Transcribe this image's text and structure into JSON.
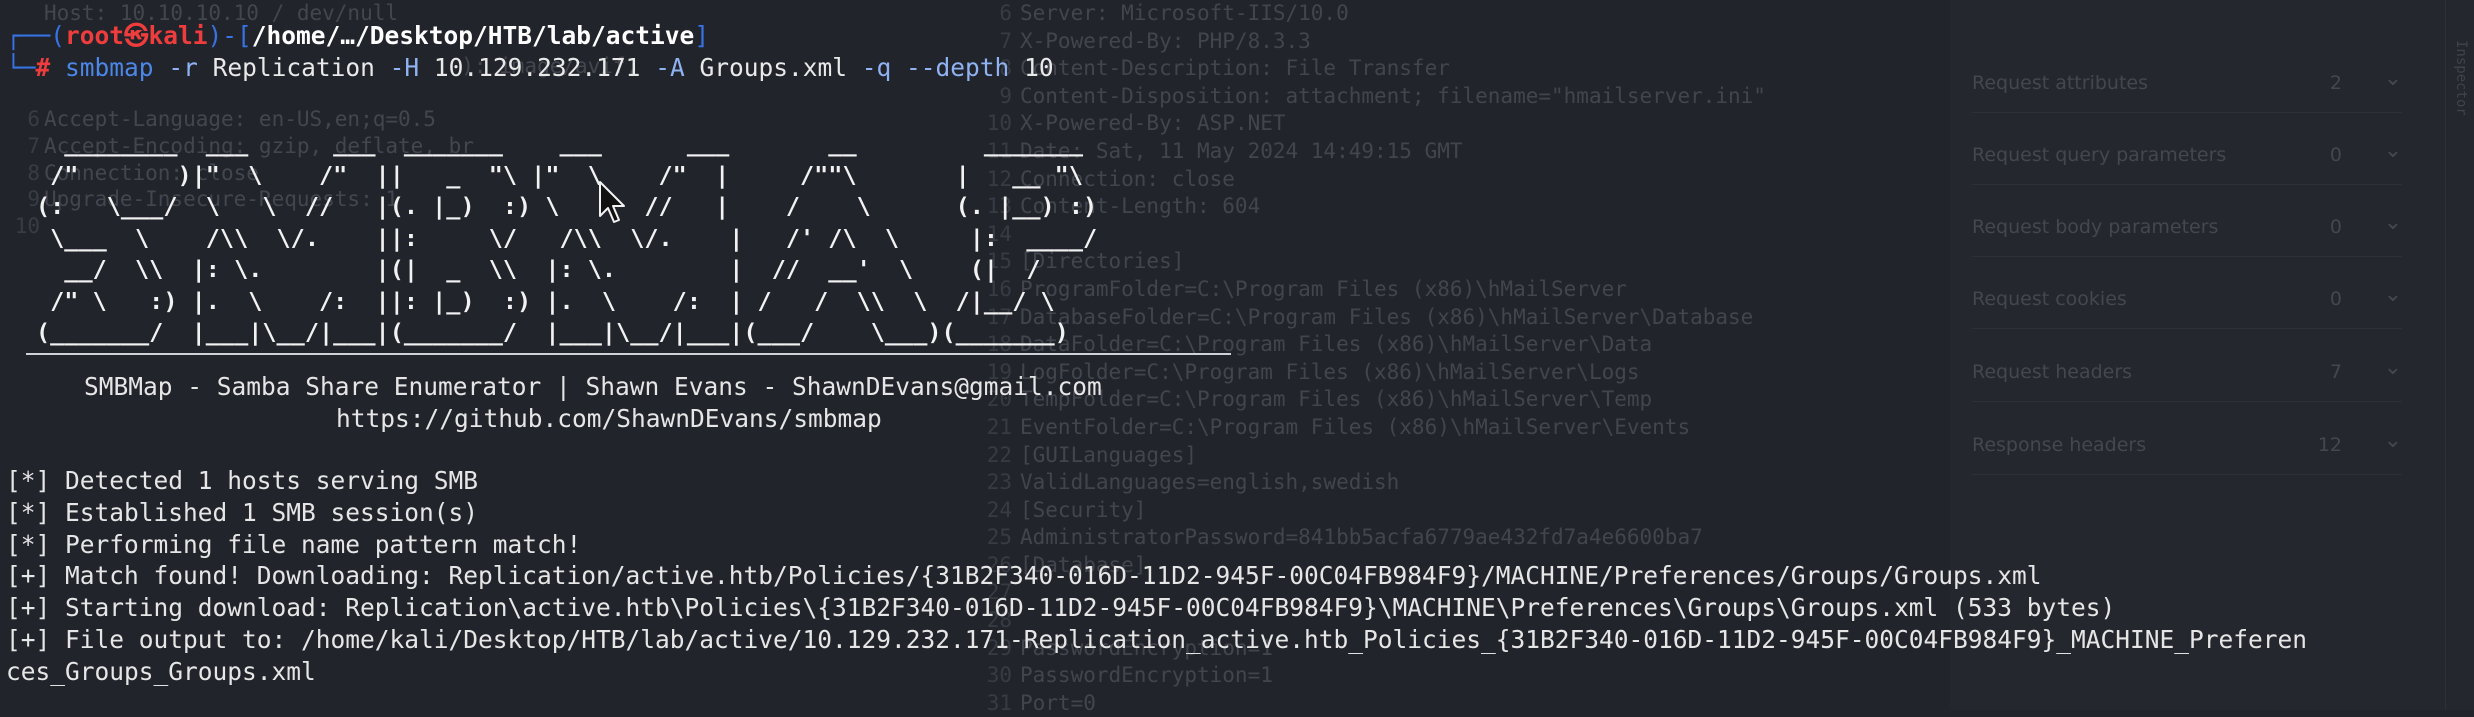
{
  "background": {
    "left_editor_lines": [
      {
        "num": "",
        "text": "Host: 10.10.10.10 / dev/null"
      },
      {
        "num": "",
        "text": ""
      },
      {
        "num": "",
        "text": "                                 ): image/avif,"
      },
      {
        "num": "",
        "text": ""
      },
      {
        "num": "6",
        "text": "Accept-Language: en-US,en;q=0.5"
      },
      {
        "num": "7",
        "text": "Accept-Encoding: gzip, deflate, br"
      },
      {
        "num": "8",
        "text": "Connection: close"
      },
      {
        "num": "9",
        "text": "Upgrade-Insecure-Requests: 1"
      },
      {
        "num": "10",
        "text": ""
      }
    ],
    "response_lines": [
      {
        "num": "6",
        "text": "Server: Microsoft-IIS/10.0"
      },
      {
        "num": "7",
        "text": "X-Powered-By: PHP/8.3.3"
      },
      {
        "num": "8",
        "text": "Content-Description: File Transfer"
      },
      {
        "num": "9",
        "text": "Content-Disposition: attachment; filename=\"hmailserver.ini\""
      },
      {
        "num": "10",
        "text": "X-Powered-By: ASP.NET"
      },
      {
        "num": "11",
        "text": "Date: Sat, 11 May 2024 14:49:15 GMT"
      },
      {
        "num": "12",
        "text": "Connection: close"
      },
      {
        "num": "13",
        "text": "Content-Length: 604"
      },
      {
        "num": "14",
        "text": ""
      },
      {
        "num": "15",
        "text": "[Directories]"
      },
      {
        "num": "16",
        "text": "ProgramFolder=C:\\Program Files (x86)\\hMailServer"
      },
      {
        "num": "17",
        "text": "DatabaseFolder=C:\\Program Files (x86)\\hMailServer\\Database"
      },
      {
        "num": "18",
        "text": "DataFolder=C:\\Program Files (x86)\\hMailServer\\Data"
      },
      {
        "num": "19",
        "text": "LogFolder=C:\\Program Files (x86)\\hMailServer\\Logs"
      },
      {
        "num": "20",
        "text": "TempFolder=C:\\Program Files (x86)\\hMailServer\\Temp"
      },
      {
        "num": "21",
        "text": "EventFolder=C:\\Program Files (x86)\\hMailServer\\Events"
      },
      {
        "num": "22",
        "text": "[GUILanguages]"
      },
      {
        "num": "23",
        "text": "ValidLanguages=english,swedish"
      },
      {
        "num": "24",
        "text": "[Security]"
      },
      {
        "num": "25",
        "text": "AdministratorPassword=841bb5acfa6779ae432fd7a4e6600ba7"
      },
      {
        "num": "26",
        "text": "[Database]"
      },
      {
        "num": "27",
        "text": ""
      },
      {
        "num": "28",
        "text": ""
      },
      {
        "num": "29",
        "text": "PasswordEncryption=1"
      },
      {
        "num": "30",
        "text": "PasswordEncryption=1"
      },
      {
        "num": "31",
        "text": "Port=0"
      }
    ],
    "inspector_rows": [
      {
        "label": "Request attributes",
        "count": "2"
      },
      {
        "label": "Request query parameters",
        "count": "0"
      },
      {
        "label": "Request body parameters",
        "count": "0"
      },
      {
        "label": "Request cookies",
        "count": "0"
      },
      {
        "label": "Request headers",
        "count": "7"
      },
      {
        "label": "Response headers",
        "count": "12"
      }
    ],
    "side_tab": "Inspector"
  },
  "prompt": {
    "corner_top": "┌──(",
    "user": "root㉿kali",
    "mid": ")-[",
    "path": "/home/…/Desktop/HTB/lab/active",
    "end": "]",
    "corner_bottom": "└─",
    "hash": "#"
  },
  "command": {
    "program": "smbmap",
    "flag_r": "-r",
    "share": "Replication",
    "flag_h": "-H",
    "host": "10.129.232.171",
    "flag_a": "-A",
    "pattern": "Groups.xml",
    "flag_q": "-q",
    "flag_depth": "--depth",
    "depth": "10"
  },
  "banner": {
    "art": "  ________  ___      ___  _______    ___      ___       __         _______\n /\"       )|\"  \\    /\"  ||   _  \"\\ |\"  \\    /\"  |     /\"\"\\       |   __ \"\\\n(:   \\___/  \\   \\  //   |(. |_)  :) \\   \\  //   |    /    \\      (. |__) :)\n \\___  \\    /\\\\  \\/.    ||:     \\/   /\\\\  \\/.    |   /' /\\  \\     |:  ____/\n  __/  \\\\  |: \\.        |(|  _  \\\\  |: \\.        |  //  __'  \\    (|  /\n /\" \\   :) |.  \\    /:  ||: |_)  :) |.  \\    /:  | /   /  \\\\  \\  /|__/ \\\n(_______/  |___|\\__/|___|(_______/  |___|\\__/|___|(___/    \\___)(_______)",
    "tagline": "SMBMap - Samba Share Enumerator | Shawn Evans - ShawnDEvans@gmail.com",
    "url": "https://github.com/ShawnDEvans/smbmap"
  },
  "output": [
    "[*] Detected 1 hosts serving SMB",
    "[*] Established 1 SMB session(s)",
    "[*] Performing file name pattern match!",
    "[+] Match found! Downloading: Replication/active.htb/Policies/{31B2F340-016D-11D2-945F-00C04FB984F9}/MACHINE/Preferences/Groups/Groups.xml",
    "[+] Starting download: Replication\\active.htb\\Policies\\{31B2F340-016D-11D2-945F-00C04FB984F9}\\MACHINE\\Preferences\\Groups\\Groups.xml (533 bytes)",
    "[+] File output to: /home/kali/Desktop/HTB/lab/active/10.129.232.171-Replication_active.htb_Policies_{31B2F340-016D-11D2-945F-00C04FB984F9}_MACHINE_Preferen",
    "ces_Groups_Groups.xml"
  ],
  "colors": {
    "terminal_bg": "#21242b",
    "prompt_bracket": "#3873e6",
    "prompt_user": "#ef3d3d",
    "command": "#4b86e8",
    "text": "#e6e6e6"
  }
}
